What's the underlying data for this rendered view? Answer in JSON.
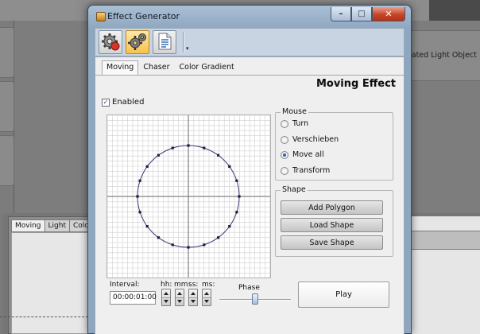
{
  "window": {
    "title": "Effect Generator",
    "caption_buttons": [
      "minimize-icon",
      "maximize-icon",
      "close-icon"
    ]
  },
  "toolbar": {
    "buttons": [
      {
        "icon": "gear-red-icon"
      },
      {
        "icon": "gears-icon",
        "active": true
      },
      {
        "icon": "document-icon"
      }
    ]
  },
  "tabs": [
    {
      "label": "Moving",
      "active": true
    },
    {
      "label": "Chaser"
    },
    {
      "label": "Color Gradient"
    }
  ],
  "heading": "Moving Effect",
  "enabled": {
    "label": "Enabled",
    "checked": true
  },
  "mouse_group": {
    "title": "Mouse",
    "options": [
      {
        "label": "Turn",
        "checked": false
      },
      {
        "label": "Verschieben",
        "checked": false
      },
      {
        "label": "Move all",
        "checked": true
      },
      {
        "label": "Transform",
        "checked": false
      }
    ]
  },
  "shape_group": {
    "title": "Shape",
    "buttons": [
      "Add Polygon",
      "Load Shape",
      "Save Shape"
    ]
  },
  "timing": {
    "interval_label": "Interval:",
    "interval_value": "00:00:01:00",
    "units": [
      "hh:",
      "mm:",
      "ss:",
      "ms:"
    ]
  },
  "phase": {
    "label": "Phase",
    "value": 0.55
  },
  "play_label": "Play",
  "background": {
    "right_panel_text": "erated Light Object",
    "lower_tabs": [
      "Moving",
      "Light",
      "Color"
    ]
  },
  "colors": {
    "accent_blue": "#2b62c9",
    "circle_line": "#3a3a78",
    "close_red": "#c6452a",
    "toolbar_active": "#f7c24e"
  }
}
